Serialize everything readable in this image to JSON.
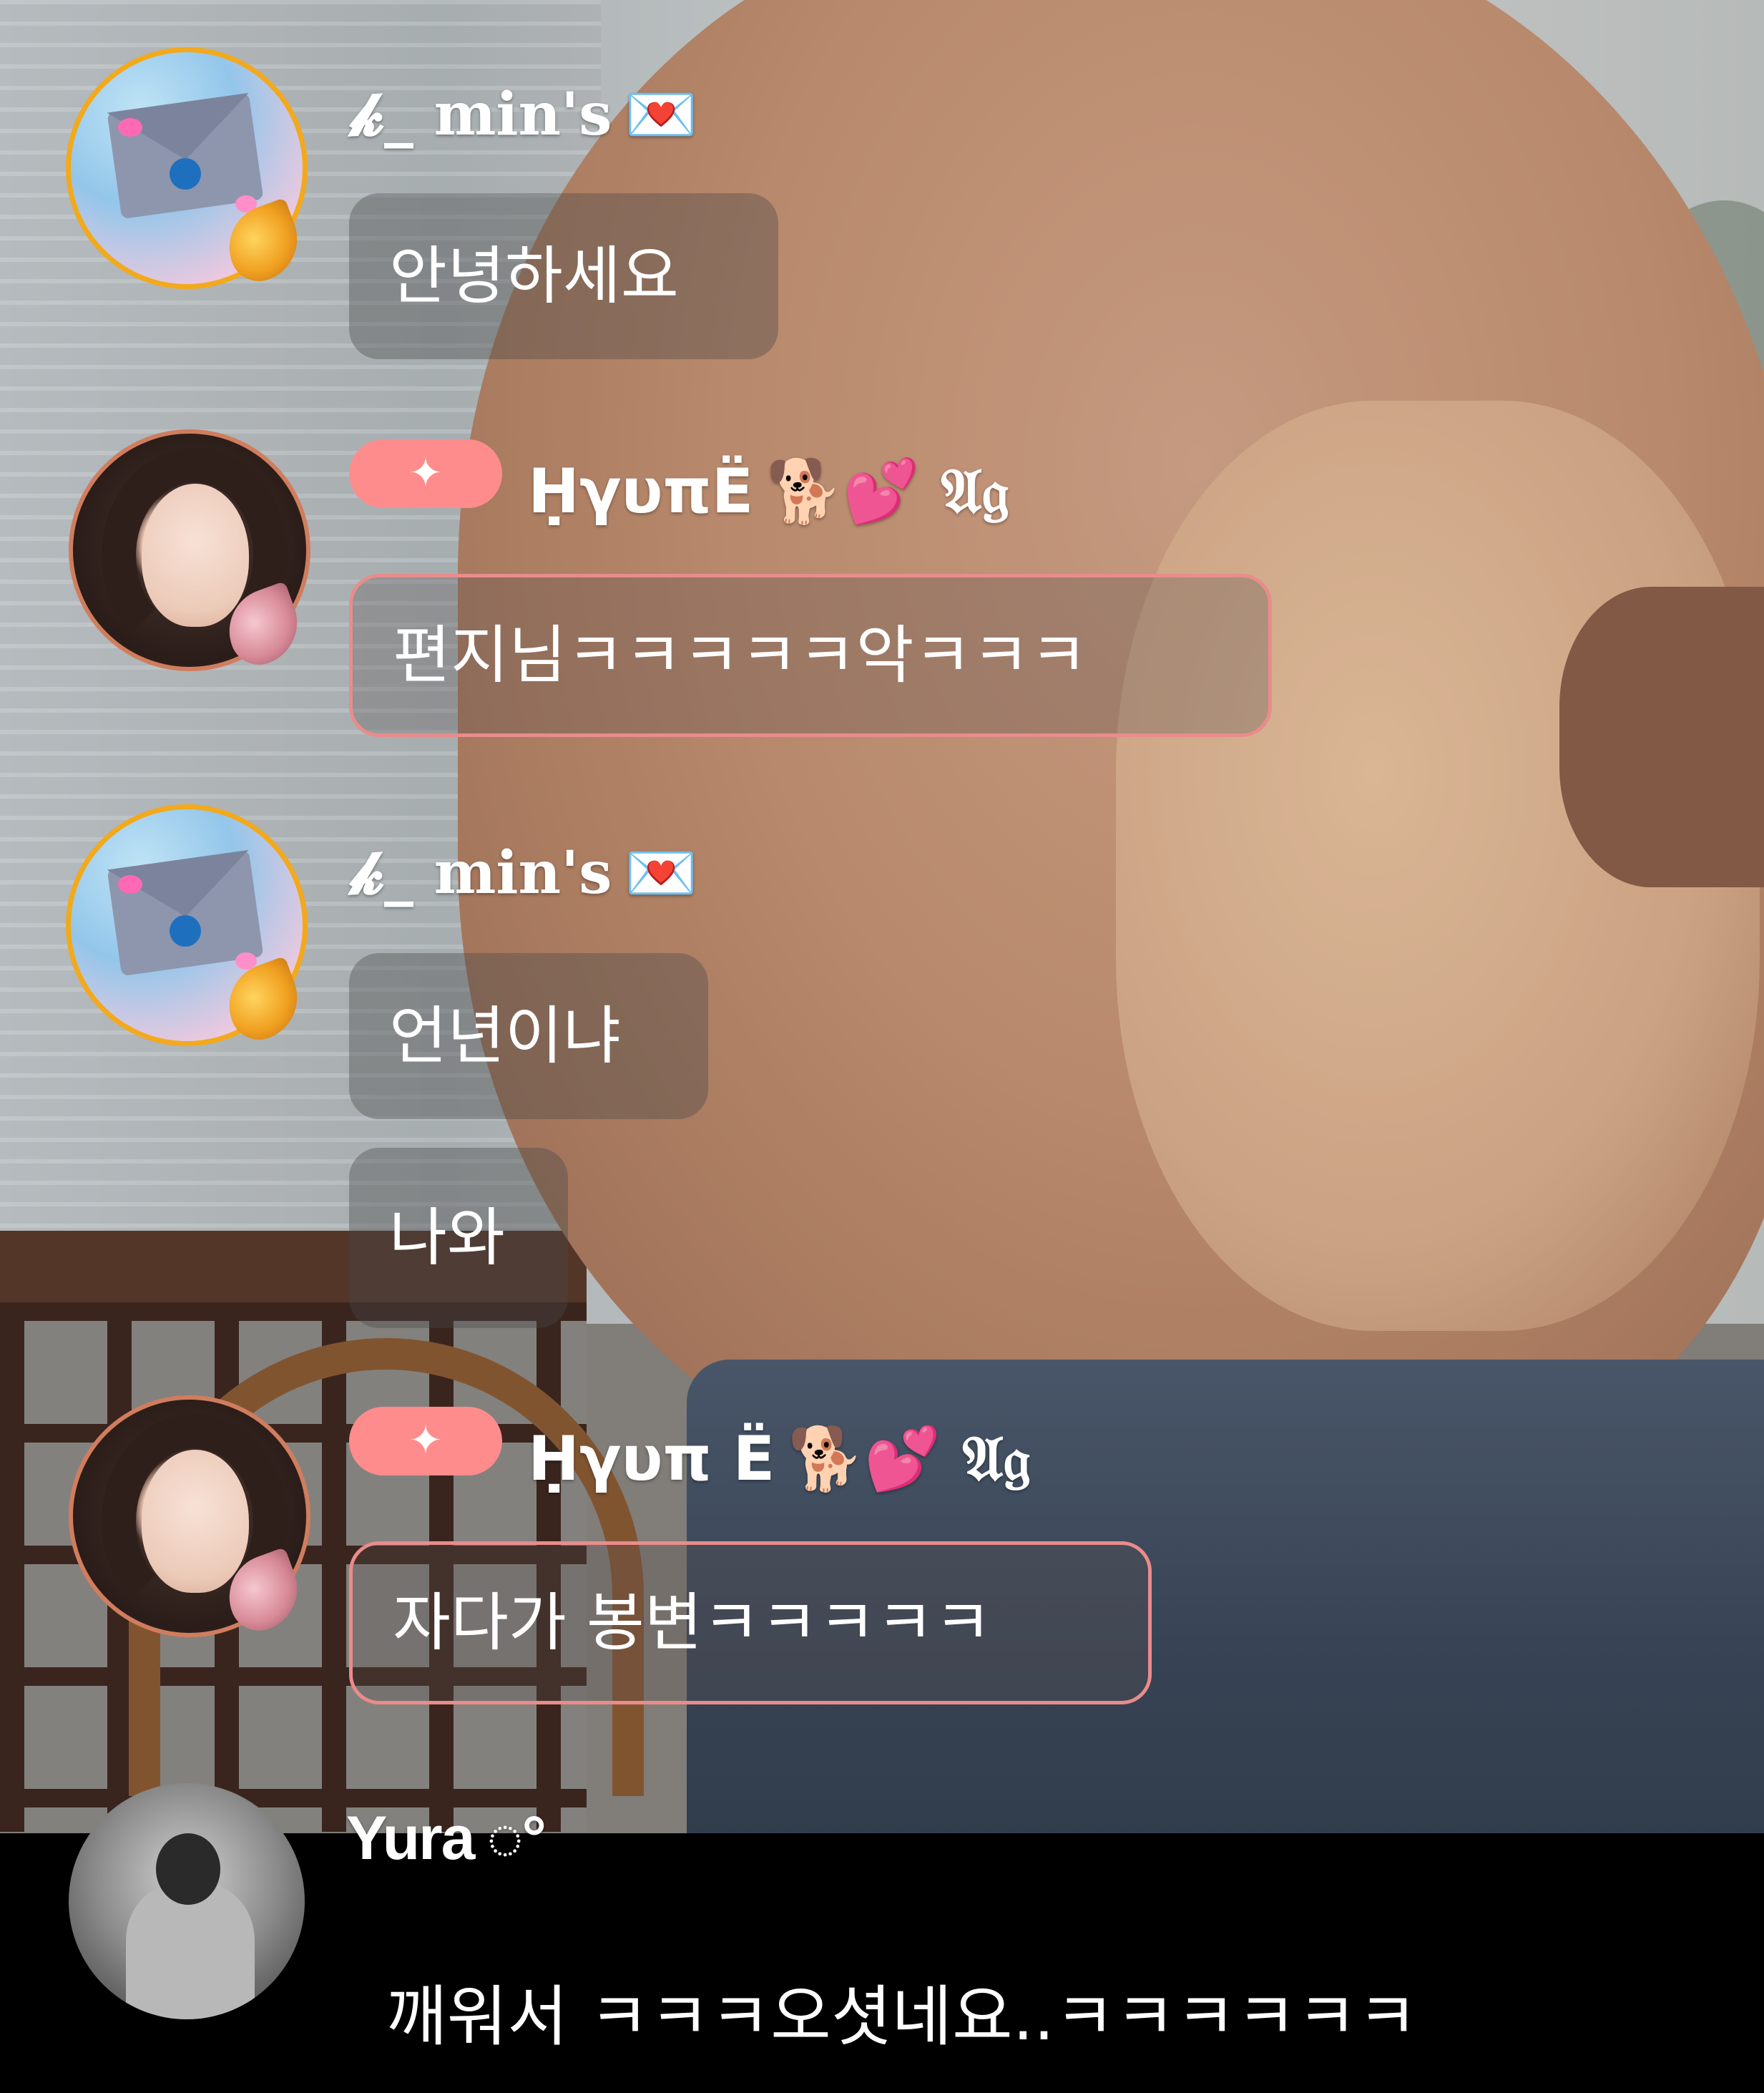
{
  "chat": {
    "messages": [
      {
        "user": "𝓴_ min's",
        "user_suffix": "💌",
        "avatar": "envelope-avatar",
        "wing": "gold",
        "text": "안녕하세요"
      },
      {
        "user": "ḤγυπЁ",
        "user_suffix": "🐕💕 𝔄𝔤",
        "badge": "✦",
        "avatar": "girl-avatar",
        "wing": "pink",
        "text": "편지님ㅋㅋㅋㅋㅋ악ㅋㅋㅋ"
      },
      {
        "user": "𝓴_ min's",
        "user_suffix": "💌",
        "avatar": "envelope-avatar",
        "wing": "gold",
        "texts": [
          "언년이냐",
          "나와"
        ]
      },
      {
        "user": "Ḥγυπ Ё",
        "user_suffix": "🐕💕 𝔄𝔤",
        "badge": "✦",
        "avatar": "girl-avatar",
        "wing": "pink",
        "text": "자다가 봉변ㅋㅋㅋㅋㅋ"
      },
      {
        "user": "Yura",
        "user_suffix": "◌°",
        "avatar": "yura-avatar",
        "text": "깨워서 ㅋㅋㅋ오셧네요..ㅋㅋㅋㅋㅋㅋ"
      }
    ]
  },
  "colors": {
    "badge": "#ff8c8c",
    "bubble_border_pink": "#e98c8c",
    "avatar_ring_gold": "#f2a91c",
    "avatar_ring_rose": "#d07d5e"
  }
}
